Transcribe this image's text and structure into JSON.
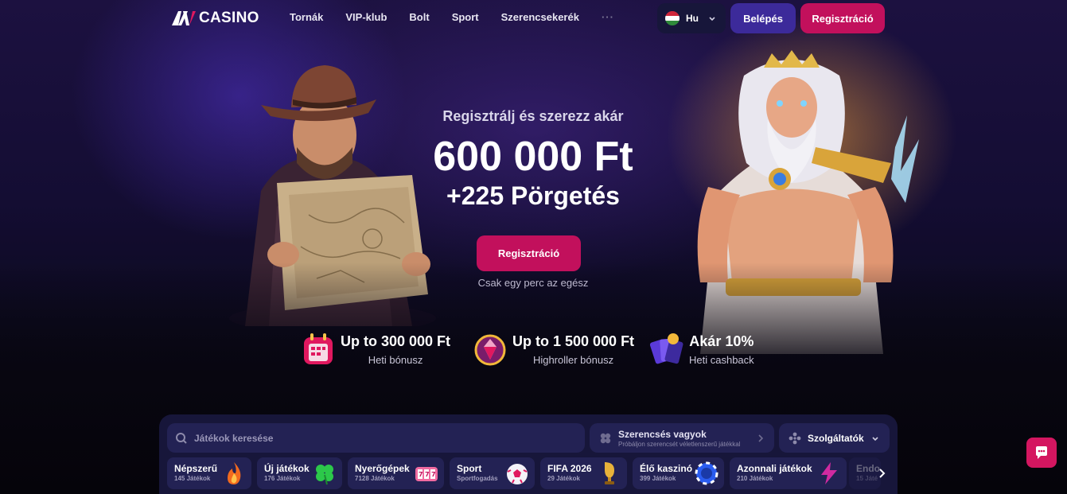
{
  "brand": {
    "logo_text": "CASINO"
  },
  "nav": {
    "items": [
      {
        "label": "Tornák"
      },
      {
        "label": "VIP-klub"
      },
      {
        "label": "Bolt"
      },
      {
        "label": "Sport"
      },
      {
        "label": "Szerencsekerék"
      }
    ],
    "more": "···"
  },
  "header": {
    "language": "Hu",
    "login_label": "Belépés",
    "register_label": "Regisztráció"
  },
  "hero": {
    "subtitle": "Regisztrálj és szerezz akár",
    "amount": "600 000 Ft",
    "spins": "+225 Pörgetés",
    "cta_label": "Regisztráció",
    "cta_note": "Csak egy perc az egész"
  },
  "bonuses": [
    {
      "title": "Up to 300 000 Ft",
      "subtitle": "Heti bónusz",
      "icon": "calendar-gift-icon"
    },
    {
      "title": "Up to 1 500 000 Ft",
      "subtitle": "Highroller bónusz",
      "icon": "gem-icon"
    },
    {
      "title": "Akár 10%",
      "subtitle": "Heti cashback",
      "icon": "cards-icon"
    }
  ],
  "games_panel": {
    "search_placeholder": "Játékok keresése",
    "lucky_title": "Szerencsés vagyok",
    "lucky_subtitle": "Próbáljon szerencsét véletlenszerű játékkal",
    "services_label": "Szolgáltatók",
    "categories": [
      {
        "label": "Népszerű",
        "count": "145 Játékok",
        "icon": "fire-icon"
      },
      {
        "label": "Új játékok",
        "count": "176 Játékok",
        "icon": "clover-icon"
      },
      {
        "label": "Nyerőgépek",
        "count": "7128 Játékok",
        "icon": "slot-reels-icon"
      },
      {
        "label": "Sport",
        "count": "Sportfogadás",
        "icon": "football-icon"
      },
      {
        "label": "FIFA 2026",
        "count": "29 Játékok",
        "icon": "trophy-icon"
      },
      {
        "label": "Élő kaszinó",
        "count": "399 Játékok",
        "icon": "chip-icon"
      },
      {
        "label": "Azonnali játékok",
        "count": "210 Játékok",
        "icon": "lightning-icon"
      },
      {
        "label": "Endo",
        "count": "15 Játé",
        "icon": "none"
      }
    ]
  },
  "colors": {
    "accent_pink": "#c2105c",
    "accent_purple": "#3c2a9a",
    "panel": "#17163a",
    "chip": "#232254"
  }
}
